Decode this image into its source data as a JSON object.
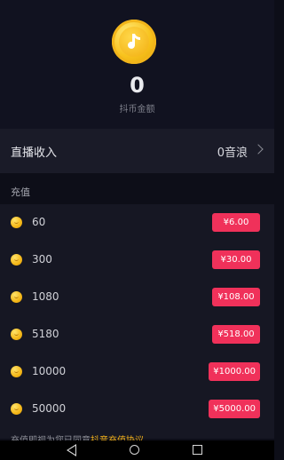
{
  "balance": {
    "amount": "0",
    "label": "抖币金额",
    "icon": "music-note-coin-icon"
  },
  "income": {
    "label": "直播收入",
    "value": "0音浪"
  },
  "recharge": {
    "section_title": "充值",
    "options": [
      {
        "amount": "60",
        "price": "¥6.00"
      },
      {
        "amount": "300",
        "price": "¥30.00"
      },
      {
        "amount": "1080",
        "price": "¥108.00"
      },
      {
        "amount": "5180",
        "price": "¥518.00"
      },
      {
        "amount": "10000",
        "price": "¥1000.00"
      },
      {
        "amount": "50000",
        "price": "¥5000.00"
      }
    ]
  },
  "footnote": {
    "text": "充值即视为您已同意",
    "link": "抖音充值协议"
  },
  "colors": {
    "background": "#0d0e18",
    "price_button": "#f0315a",
    "coin": "#f8c21c"
  }
}
